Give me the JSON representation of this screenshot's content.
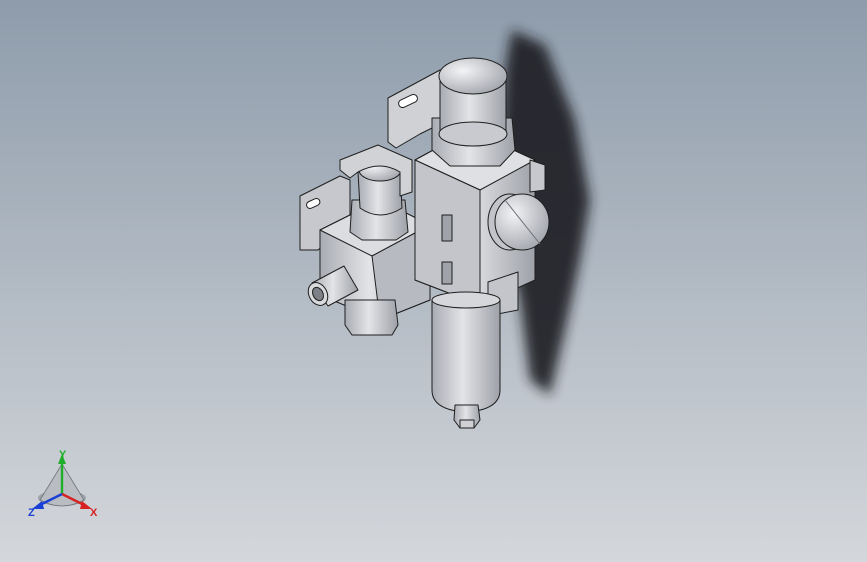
{
  "viewport": {
    "background_top": "#8e9cab",
    "background_bottom": "#d4d7db",
    "part_fill": "#c9cbd0",
    "part_shade": "#a9acb3",
    "edge_color": "#1e1e1e",
    "shadow_color": "#1c1f24"
  },
  "triad": {
    "x_label": "X",
    "y_label": "Y",
    "z_label": "Z",
    "x_color": "#d62222",
    "y_color": "#1fae2a",
    "z_color": "#1a3fd6"
  }
}
